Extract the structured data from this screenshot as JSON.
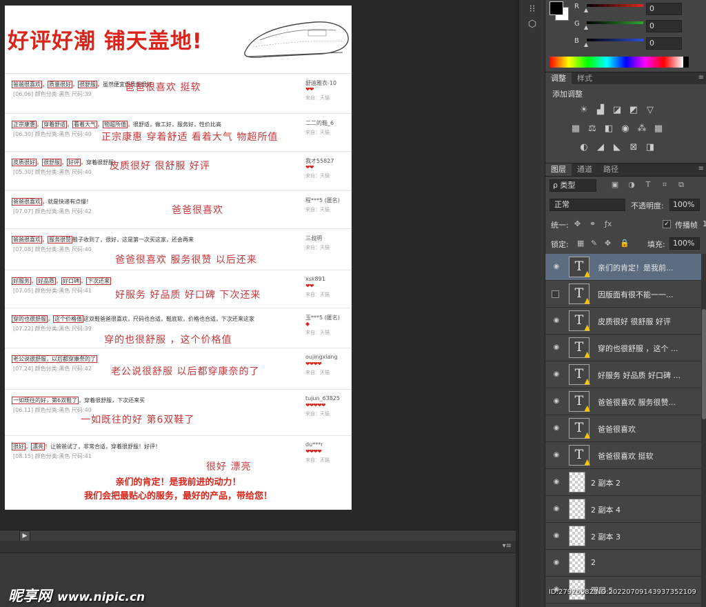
{
  "document": {
    "title": "好评好潮  铺天盖地!",
    "reviews": [
      {
        "line1_tags": [
          "爸爸很喜欢",
          "质量很好",
          "很舒服"
        ],
        "line1_text": "，虽然便宜但质量很好",
        "meta": "[06.06]  颜色分类:黑色  尺码:39",
        "big": "爸爸很喜欢  挺软",
        "user": "舒迪雅衣-10",
        "from": "来自：天猫",
        "hearts": "❤❤"
      },
      {
        "line1_tags": [
          "正宗康惠",
          "穿着舒适",
          "看着大气",
          "物超所值"
        ],
        "line1_text": "，很舒适，做工好，服务好，性价比高",
        "meta": "[06.30]  颜色分类:黑色  尺码:40",
        "big": "正宗康惠  穿着舒适  看着大气  物超所值",
        "user": "二二的鞋_6",
        "from": "来自：天猫",
        "hearts": ""
      },
      {
        "line1_tags": [
          "皮质很好",
          "很舒服",
          "好评"
        ],
        "line1_text": "，穿着很舒服",
        "meta": "[05.30]  颜色分类:黑色  尺码:40",
        "big": "皮质很好  很舒服  好评",
        "user": "我才55827",
        "from": "来自：天猫",
        "hearts": "❤❤"
      },
      {
        "line1_tags": [
          "爸爸很喜欢"
        ],
        "line1_text": "，就是快递有点慢！",
        "meta": "[07.07]  颜色分类:黑色  尺码:42",
        "big": "爸爸很喜欢",
        "user": "程***5 (匿名)",
        "from": "来自：天猫",
        "hearts": ""
      },
      {
        "line1_tags": [
          "爸爸很喜欢",
          "服务很赞"
        ],
        "line1_text": "鞋子收到了，很好，这是第一次买这家，还会再来",
        "meta": "[07.08]  颜色分类:黑色  尺码:40",
        "big": "爸爸很喜欢   服务很赞  以后还来",
        "user": "三叔明",
        "from": "来自：天猫",
        "hearts": ""
      },
      {
        "line1_tags": [
          "好服务",
          "好品质",
          "好口碑",
          "下次还来"
        ],
        "line1_text": "",
        "meta": "[07.05]  颜色分类:黑色  尺码:41",
        "big": "好服务  好品质   好口碑   下次还来",
        "user": "xsk891",
        "from": "来自：天猫",
        "hearts": "❤❤"
      },
      {
        "line1_tags": [
          "穿的也很舒服",
          "这个价格值"
        ],
        "line1_text": "这双鞋爸爸很喜欢，尺码也合适，鞋底软，价格也合适，下次还来这家",
        "meta": "[07.22]  颜色分类:黑色  尺码:39",
        "big": "穿的也很舒服 ，这个价格值",
        "user": "玉***5 (匿名)",
        "from": "来自：天猫",
        "hearts": "◆"
      },
      {
        "line1_tags": [
          "老公说很舒服，以后都穿康奈的了"
        ],
        "line1_text": "",
        "meta": "[07.24]  颜色分类:黑色  尺码:42",
        "big": "老公说很舒服   以后都穿康奈的了",
        "user": "oujingxiang",
        "from": "来自：天猫",
        "hearts": "❤❤❤❤"
      },
      {
        "line1_tags": [
          "一如既往的好，第6双鞋了"
        ],
        "line1_text": "，穿着很舒服，下次还来买",
        "meta": "[06.11]  颜色分类:黑色  尺码:40",
        "big": "一如既往的好   第6双鞋了",
        "user": "tujun_63825",
        "from": "来自：天猫",
        "hearts": "❤❤❤❤❤"
      },
      {
        "line1_tags": [
          "很好",
          "漂亮"
        ],
        "line1_text": "！让爸爸试了，非常合适，穿着很舒服！好评！",
        "meta": "[08.15]  颜色分类:黑色  尺码:41",
        "big": "很好  漂亮",
        "user": "du***r",
        "from": "来自：天猫",
        "hearts": "❤❤❤❤"
      }
    ],
    "footer_line1": "亲们的肯定！是我前进的动力！",
    "footer_line2": "我们会把最贴心的服务，最好的产品，带给您！"
  },
  "color_panel": {
    "channels": [
      {
        "label": "R",
        "value": "0",
        "color": "#e0281e"
      },
      {
        "label": "G",
        "value": "0",
        "color": "#2ea52e"
      },
      {
        "label": "B",
        "value": "0",
        "color": "#2a4fd9"
      }
    ]
  },
  "adjust_tabs": [
    "调整",
    "样式"
  ],
  "adjust_label": "添加调整",
  "layer_tabs": [
    "图层",
    "通道",
    "路径"
  ],
  "layers_panel": {
    "filter_label": "ρ 类型",
    "blend_mode": "正常",
    "opacity_label": "不透明度:",
    "opacity_value": "100%",
    "unify_label": "统一:",
    "propagate_label": "传播帧",
    "propagate_suffix": "1",
    "lock_label": "锁定:",
    "fill_label": "填充:",
    "fill_value": "100%"
  },
  "layers": [
    {
      "name": "亲们的肯定！是我前...",
      "type": "text",
      "visible": true,
      "selected": true
    },
    {
      "name": "因版面有很不能一一...",
      "type": "text",
      "visible": false,
      "selected": false
    },
    {
      "name": "皮质很好 很舒服 好评",
      "type": "text",
      "visible": true,
      "selected": false
    },
    {
      "name": "穿的也很舒服 ，这个 ...",
      "type": "text",
      "visible": true,
      "selected": false
    },
    {
      "name": "好服务 好品质 好口碑 ...",
      "type": "text",
      "visible": true,
      "selected": false
    },
    {
      "name": "爸爸很喜欢  服务很赞...",
      "type": "text",
      "visible": true,
      "selected": false
    },
    {
      "name": "爸爸很喜欢",
      "type": "text",
      "visible": true,
      "selected": false
    },
    {
      "name": "爸爸很喜欢  挺软",
      "type": "text",
      "visible": true,
      "selected": false
    },
    {
      "name": "2 副本 2",
      "type": "image",
      "visible": true,
      "selected": false
    },
    {
      "name": "2 副本 4",
      "type": "image",
      "visible": true,
      "selected": false
    },
    {
      "name": "2 副本 3",
      "type": "image",
      "visible": true,
      "selected": false
    },
    {
      "name": "2",
      "type": "image",
      "visible": true,
      "selected": false
    },
    {
      "name": "图层 5",
      "type": "image",
      "visible": true,
      "selected": false
    }
  ],
  "watermark": {
    "brand": "昵享网",
    "url": "www.nipic.cn"
  },
  "image_id": "ID:27926582 NO:20220709143937352109"
}
